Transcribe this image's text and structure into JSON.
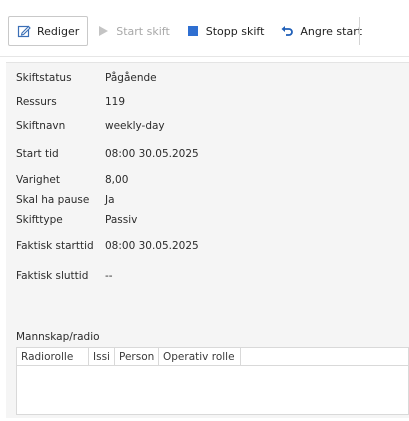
{
  "toolbar": {
    "edit_label": "Rediger",
    "start_label": "Start skift",
    "stop_label": "Stopp skift",
    "undo_label": "Angre start",
    "stop_icon_color": "#2f6fd1",
    "undo_icon_color": "#1f5fb8"
  },
  "details": {
    "status_label": "Skiftstatus",
    "status_value": "Pågående",
    "resource_label": "Ressurs",
    "resource_value": "119",
    "name_label": "Skiftnavn",
    "name_value": "weekly-day",
    "start_label": "Start tid",
    "start_value": "08:00 30.05.2025",
    "duration_label": "Varighet",
    "duration_value": "8,00",
    "pause_label": "Skal ha pause",
    "pause_value": "Ja",
    "type_label": "Skifttype",
    "type_value": "Passiv",
    "actual_start_label": "Faktisk starttid",
    "actual_start_value": "08:00 30.05.2025",
    "actual_end_label": "Faktisk sluttid",
    "actual_end_value": "--"
  },
  "crew": {
    "title": "Mannskap/radio",
    "columns": [
      "Radiorolle",
      "Issi",
      "Person",
      "Operativ rolle"
    ]
  }
}
